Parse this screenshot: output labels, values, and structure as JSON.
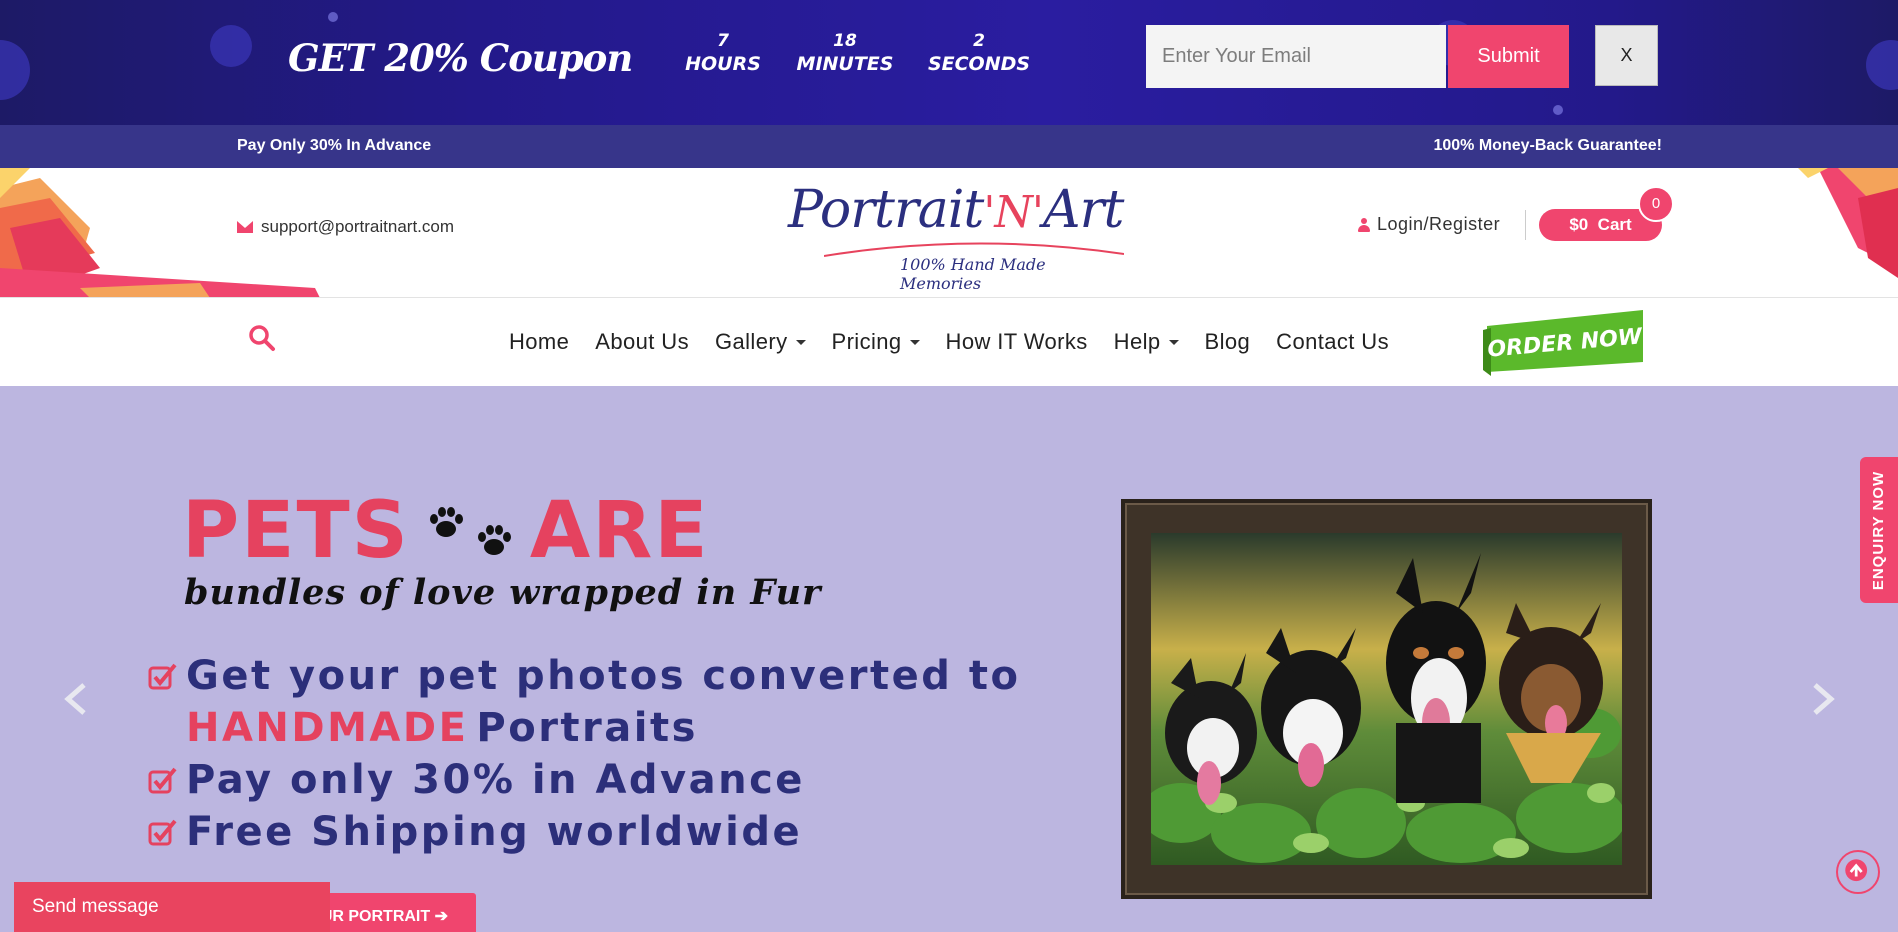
{
  "coupon_bar": {
    "title": "GET 20% Coupon",
    "countdown": [
      {
        "value": "7",
        "label": "HOURS"
      },
      {
        "value": "18",
        "label": "MINUTES"
      },
      {
        "value": "2",
        "label": "SECONDS"
      }
    ],
    "email_placeholder": "Enter Your Email",
    "submit_label": "Submit",
    "close_label": "X"
  },
  "promo_strip": {
    "left": "Pay Only 30% In Advance",
    "right": "100% Money-Back Guarantee!"
  },
  "header": {
    "support_email": "support@portraitnart.com",
    "logo_text_1": "Portrait",
    "logo_text_2": "'N'",
    "logo_text_3": "Art",
    "logo_tagline": "100% Hand Made Memories",
    "login_label": "Login/Register",
    "cart_label": "$0  Cart",
    "cart_count": "0"
  },
  "nav": {
    "items": [
      {
        "label": "Home",
        "dropdown": false
      },
      {
        "label": "About Us",
        "dropdown": false
      },
      {
        "label": "Gallery",
        "dropdown": true
      },
      {
        "label": "Pricing",
        "dropdown": true
      },
      {
        "label": "How IT Works",
        "dropdown": false
      },
      {
        "label": "Help",
        "dropdown": true
      },
      {
        "label": "Blog",
        "dropdown": false
      },
      {
        "label": "Contact Us",
        "dropdown": false
      }
    ],
    "order_now": "ORDER NOW"
  },
  "hero": {
    "headline_left": "PETS",
    "headline_right": "ARE",
    "subheadline": "bundles of love wrapped in Fur",
    "bullet_1": "Get your pet photos converted to",
    "bullet_1b_pink": "HANDMADE",
    "bullet_1b_rest": "Portraits",
    "bullet_2": "Pay only 30% in Advance",
    "bullet_3": "Free Shipping worldwide",
    "cta_label": "UR PORTRAIT ➔"
  },
  "widgets": {
    "enquiry": "ENQUIRY NOW",
    "send_message": "Send message"
  },
  "colors": {
    "accent": "#f0456e",
    "navy": "#2c2f7a",
    "coupon_bg": "#23198a",
    "hero_bg": "#bcb6e0"
  }
}
